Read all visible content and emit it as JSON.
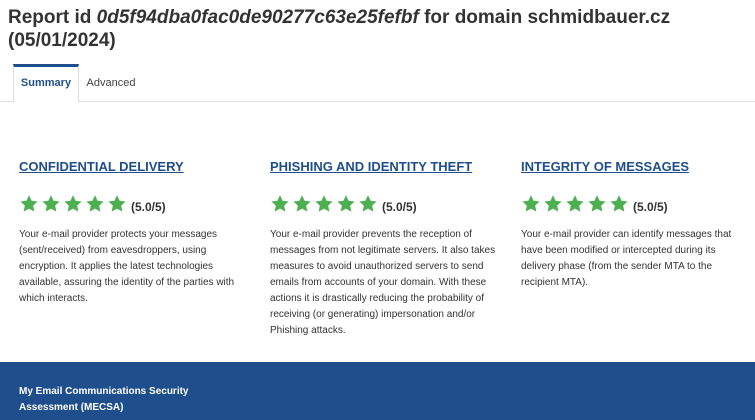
{
  "header": {
    "prefix": "Report id ",
    "report_id": "0d5f94dba0fac0de90277c63e25fefbf",
    "middle": " for domain ",
    "domain": "schmidbauer.cz",
    "date": "(05/01/2024)"
  },
  "tabs": [
    {
      "label": "Summary",
      "active": true
    },
    {
      "label": "Advanced",
      "active": false
    }
  ],
  "star_color": "#4caf50",
  "accent_color": "#1f4e8c",
  "sections": [
    {
      "title": "CONFIDENTIAL DELIVERY",
      "stars": 5,
      "score": "(5.0/5)",
      "description": "Your e-mail provider protects your messages (sent/received) from eavesdroppers, using encryption. It applies the latest technologies available, assuring the identity of the parties with which interacts."
    },
    {
      "title": "PHISHING AND IDENTITY THEFT",
      "stars": 5,
      "score": "(5.0/5)",
      "description": "Your e-mail provider prevents the reception of messages from not legitimate servers. It also takes measures to avoid unauthorized servers to send emails from accounts of your domain. With these actions it is drastically reducing the probability of receiving (or generating) impersonation and/or Phishing attacks."
    },
    {
      "title": "INTEGRITY OF MESSAGES",
      "stars": 5,
      "score": "(5.0/5)",
      "description": "Your e-mail provider can identify messages that have been modified or intercepted during its delivery phase (from the sender MTA to the recipient MTA)."
    }
  ],
  "footer": {
    "text": "My Email Communications Security Assessment (MECSA)"
  }
}
